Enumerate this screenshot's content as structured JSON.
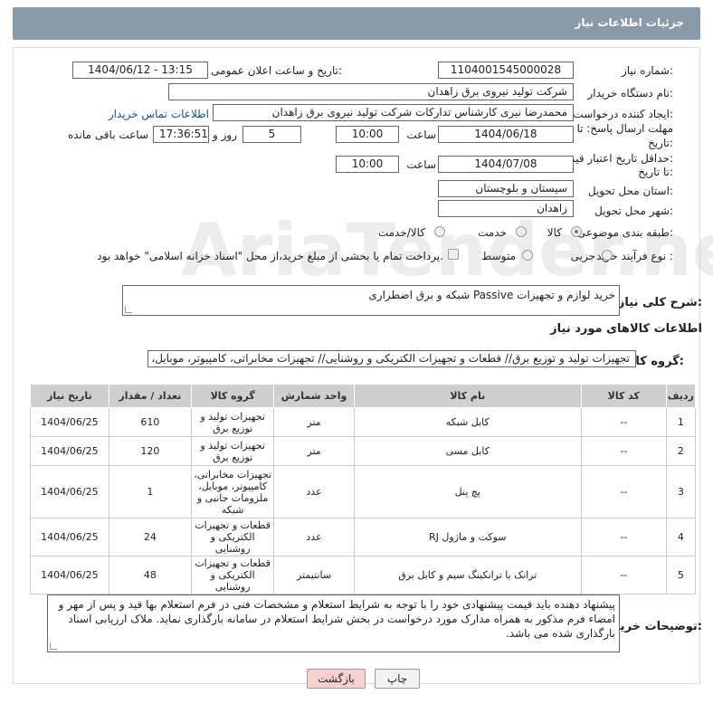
{
  "title": "جزئیات اطلاعات نیاز",
  "watermark": "AriaTender.net",
  "form": {
    "need_number_label": "شماره نیاز:",
    "need_number": "1104001545000028",
    "announce_label": "تاریخ و ساعت اعلان عمومی:",
    "announce_value": "1404/06/12 - 13:15",
    "buyer_label": "نام دستگاه خریدار:",
    "buyer_value": "شرکت تولید نیروی برق زاهدان",
    "creator_label": "ایجاد کننده درخواست:",
    "creator_value": "محمدرضا نیری کارشناس تدارکات شرکت تولید نیروی برق زاهدان",
    "contact_link": "اطلاعات تماس خریدار",
    "deadline_label_1": "مهلت ارسال پاسخ: تا",
    "deadline_label_2": "تاریخ:",
    "deadline_date": "1404/06/18",
    "time_label": "ساعت",
    "deadline_time": "10:00",
    "days_value": "5",
    "days_label": "روز و",
    "remaining_time": "17:36:51",
    "remaining_label": "ساعت باقی مانده",
    "validity_label_1": "حداقل تاریخ اعتبار قیمت:",
    "validity_label_2": "تا تاریخ:",
    "validity_date": "1404/07/08",
    "validity_time": "10:00",
    "province_label": "استان محل تحویل:",
    "province_value": "سیستان و بلوچستان",
    "city_label": "شهر محل تحویل:",
    "city_value": "زاهدان",
    "category_label": "طبقه بندی موضوعی:",
    "category_options": [
      "کالا",
      "خدمت",
      "کالا/خدمت"
    ],
    "process_label": "نوع فرآیند خرید :",
    "process_options": [
      "جزیی",
      "متوسط"
    ],
    "payment_note": "پرداخت تمام یا بخشی از مبلغ خرید،از محل \"اسناد خزانه اسلامی\" خواهد بود.",
    "summary_label": "شرح کلی نیاز:",
    "summary_value": "خرید لوازم و تجهیزات Passive شبکه و برق اضطراری",
    "goods_info_label": "اطلاعات کالاهای مورد نیاز",
    "group_label": "گروه کالا:",
    "group_value": "تجهیزات تولید و توزیع برق// قطعات و تجهیزات الکتریکی و روشنایی// تجهیزات مخابراتی، کامپیوتر، موبایل، ملزو"
  },
  "table": {
    "headers": [
      "ردیف",
      "کد کالا",
      "نام کالا",
      "واحد شمارش",
      "گروه کالا",
      "تعداد / مقدار",
      "تاریخ نیاز"
    ],
    "rows": [
      {
        "row": "1",
        "code": "--",
        "name": "کابل شبکه",
        "unit": "متر",
        "group": "تجهیزات تولید و توزیع برق",
        "qty": "610",
        "date": "1404/06/25"
      },
      {
        "row": "2",
        "code": "--",
        "name": "کابل مسی",
        "unit": "متر",
        "group": "تجهیزات تولید و توزیع برق",
        "qty": "120",
        "date": "1404/06/25"
      },
      {
        "row": "3",
        "code": "--",
        "name": "پچ پنل",
        "unit": "عدد",
        "group": "تجهیزات مخابراتی، کامپیوتر، موبایل، ملزومات جانبی و شبکه",
        "qty": "1",
        "date": "1404/06/25"
      },
      {
        "row": "4",
        "code": "--",
        "name": "سوکت و ماژول RJ",
        "unit": "عدد",
        "group": "قطعات و تجهیزات الکتریکی و روشنایی",
        "qty": "24",
        "date": "1404/06/25"
      },
      {
        "row": "5",
        "code": "--",
        "name": "ترانک یا ترانکینگ سیم و کابل برق",
        "unit": "سانتیمتر",
        "group": "قطعات و تجهیزات الکتریکی و روشنایی",
        "qty": "48",
        "date": "1404/06/25"
      }
    ]
  },
  "notes_label": "توضیحات خریدار:",
  "notes_value": "پیشنهاد دهنده باید قیمت پیشنهادی خود را با توجه به شرایط استعلام و مشخصات فنی در فرم استعلام بها قید و پس از مهر و امضاء فرم مذکور به همراه مدارک مورد درخواست در بخش شرایط استعلام در سامانه بارگذاری نماید. ملاک ارزیابی اسناد بارگذاری شده می باشد.",
  "buttons": {
    "print": "چاپ",
    "back": "بازگشت"
  },
  "colors": {
    "titlebar": "#8a9aa8",
    "back_button": "#f7d0d0",
    "print_button": "#f2f2f2"
  }
}
